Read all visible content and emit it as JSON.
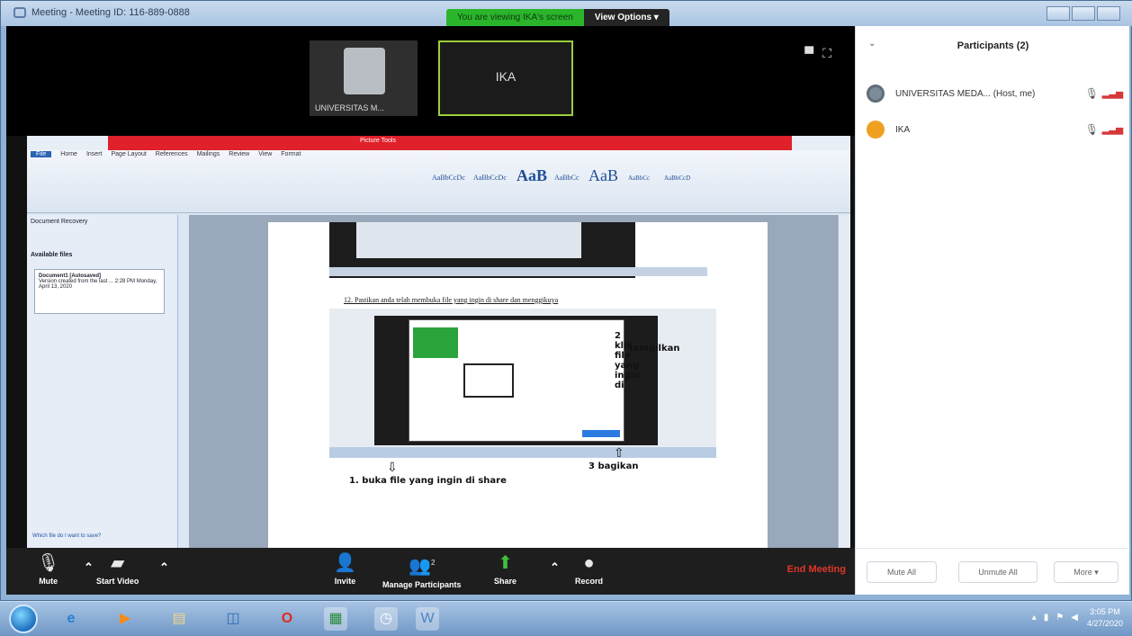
{
  "window": {
    "title": "Meeting - Meeting ID: 116-889-0888",
    "viewing_banner": "You are viewing IKA's screen",
    "view_options_label": "View Options ▾"
  },
  "video_tiles": [
    {
      "name": "UNIVERSITAS M..."
    },
    {
      "name": "IKA"
    }
  ],
  "shared_screen": {
    "picture_tools_label": "Picture Tools",
    "ribbon_tabs": [
      "File",
      "Home",
      "Insert",
      "Page Layout",
      "References",
      "Mailings",
      "Review",
      "View",
      "Format"
    ],
    "styles": [
      "AaBbCcDc",
      "AaBbCcDc",
      "AaB",
      "AaBbCc",
      "AaB",
      "AaBbCc",
      "AaBbCcD"
    ],
    "nav_header": "Document Recovery",
    "available_files_label": "Available files",
    "recovered_file": "Document1 [Autosaved]",
    "recovered_file_detail": "Version created from the last ... 2:28 PM Monday, April 13, 2020",
    "help_link": "Which file do I want to save?",
    "step_text": "12. Pastikan anda telah membuka file yang ingin di share dan menggikuya",
    "annotation_click": "2 klik file yang ingin di",
    "annotation_click_2": "tampilkan",
    "annotation_share": "1. buka file yang ingin di share",
    "annotation_bagikan": "3 bagikan"
  },
  "toolbar": {
    "mute_label": "Mute",
    "start_video_label": "Start Video",
    "invite_label": "Invite",
    "manage_participants_label": "Manage Participants",
    "participants_count": "2",
    "share_label": "Share",
    "record_label": "Record",
    "end_meeting_label": "End Meeting"
  },
  "participants": {
    "title": "Participants (2)",
    "list": [
      {
        "name": "UNIVERSITAS MEDA... (Host, me)",
        "avatar_color": "#7d8c99"
      },
      {
        "name": "IKA",
        "avatar_color": "#f0a020"
      }
    ],
    "mute_all_label": "Mute All",
    "unmute_all_label": "Unmute All",
    "more_label": "More ▾"
  },
  "taskbar": {
    "time": "3:05 PM",
    "date": "4/27/2020"
  }
}
